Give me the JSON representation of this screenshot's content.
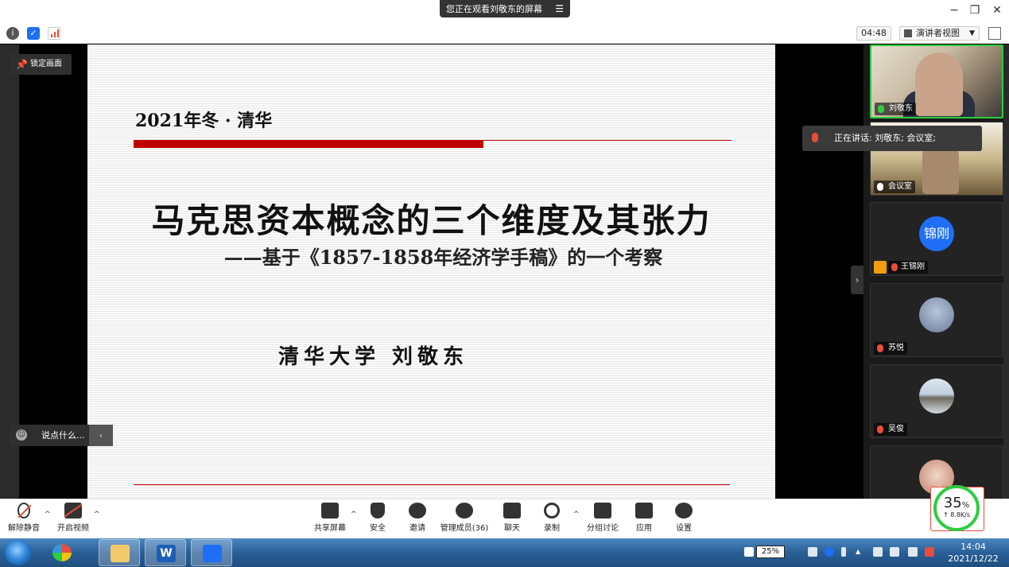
{
  "window": {
    "share_status": "您正在观看刘敬东的屏幕",
    "minimize_label": "−",
    "restore_label": "❐",
    "close_label": "✕"
  },
  "toolrow": {
    "timer": "04:48",
    "view_mode": "演讲者视图"
  },
  "stage": {
    "lock_screen_label": "锁定画面",
    "chat_placeholder": "说点什么..."
  },
  "slide": {
    "year_line": "2021年冬 · 清华",
    "title": "马克思资本概念的三个维度及其张力",
    "subtitle": "——基于《1857-1858年经济学手稿》的一个考察",
    "author": "清华大学  刘敬东"
  },
  "speaking_tip": "正在讲话: 刘敬东; 会议室;",
  "participants": [
    {
      "name": "刘敬东",
      "mic": "on",
      "kind": "video1",
      "active": true
    },
    {
      "name": "会议室",
      "mic": "white",
      "kind": "video2",
      "active": false
    },
    {
      "name": "王锦刚",
      "mic": "off",
      "kind": "text",
      "avatar_text": "锦刚",
      "active": false
    },
    {
      "name": "苏悦",
      "mic": "off",
      "kind": "photo",
      "active": false
    },
    {
      "name": "吴俊",
      "mic": "off",
      "kind": "photo",
      "active": false
    },
    {
      "name": "",
      "mic": "off",
      "kind": "photo",
      "active": false
    }
  ],
  "toolbar": {
    "unmute": "解除静音",
    "start_video": "开启视频",
    "share_screen": "共享屏幕",
    "security": "安全",
    "invite": "邀请",
    "manage_members": "管理成员(36)",
    "chat": "聊天",
    "record": "录制",
    "breakout": "分组讨论",
    "apps": "应用",
    "settings": "设置"
  },
  "network": {
    "percent": "35",
    "percent_unit": "%",
    "speed": "↑ 8.8K/s"
  },
  "taskbar": {
    "battery": "25%",
    "time": "14:04",
    "date": "2021/12/22"
  },
  "colors": {
    "accent_red": "#c00000",
    "active_green": "#2ecc40",
    "avatar_blue": "#1e6ff5"
  }
}
